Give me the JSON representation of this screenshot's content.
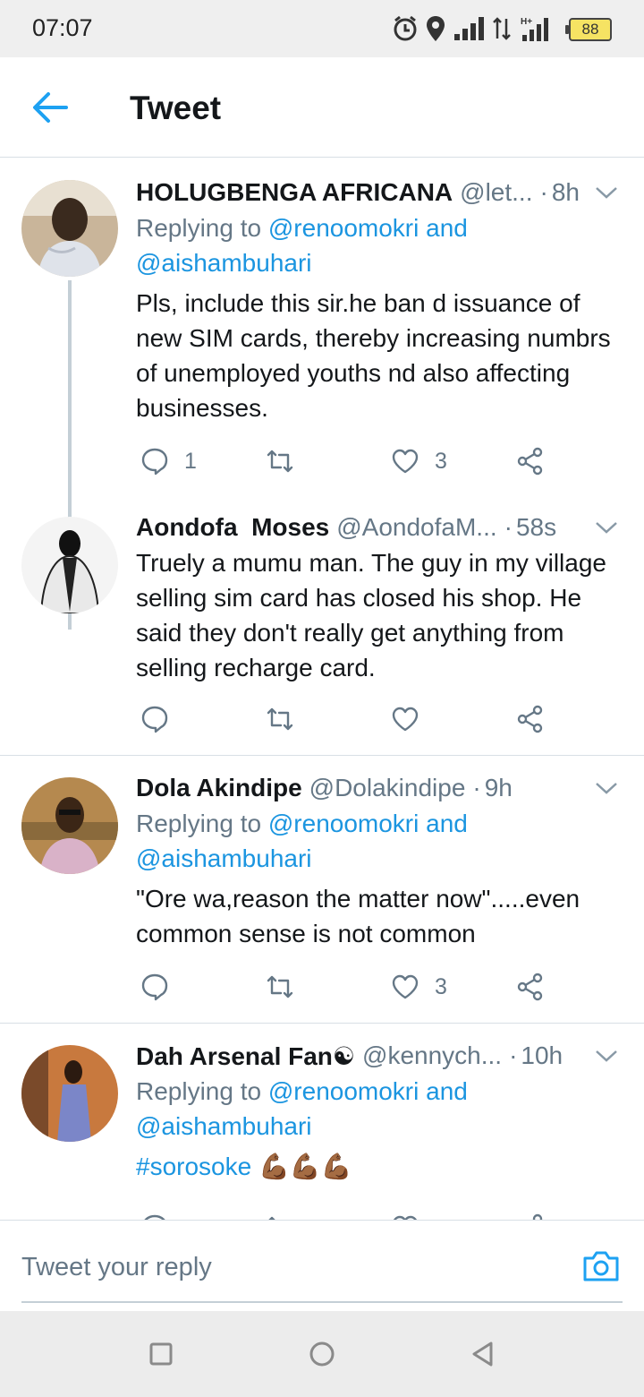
{
  "status_bar": {
    "time": "07:07",
    "battery": "88"
  },
  "header": {
    "title": "Tweet"
  },
  "tweets": [
    {
      "name": "HOLUGBENGA AFRICANA",
      "handle": "@let...",
      "time": "8h",
      "replying_prefix": "Replying to",
      "replying_to": "@renoomokri and",
      "replying_to_2": "@aishambuhari",
      "text": "Pls, include this sir.he ban d issuance of new SIM cards, thereby increasing numbrs of unemployed youths nd also affecting businesses.",
      "replies": "1",
      "likes": "3"
    },
    {
      "name": "Aondofa  Moses",
      "handle": "@AondofaM...",
      "time": "58s",
      "text": "Truely a mumu man. The guy in my village selling sim card has closed his shop. He said they don't really get anything from selling recharge card."
    },
    {
      "name": "Dola Akindipe",
      "handle": "@Dolakindipe",
      "time": "9h",
      "replying_prefix": "Replying to",
      "replying_to": "@renoomokri and",
      "replying_to_2": "@aishambuhari",
      "text": "\"Ore wa,reason the matter now\".....even common sense is not common",
      "likes": "3"
    },
    {
      "name": "Dah Arsenal Fan☯",
      "handle": "@kennych...",
      "time": "10h",
      "replying_prefix": "Replying to",
      "replying_to": "@renoomokri and",
      "replying_to_2": "@aishambuhari",
      "hashtag": "#sorosoke",
      "emoji": "💪🏾💪🏾💪🏾"
    }
  ],
  "reply_bar": {
    "placeholder": "Tweet your reply"
  },
  "icons": {
    "back": "arrow-left-icon",
    "reply": "comment-icon",
    "retweet": "retweet-icon",
    "like": "heart-icon",
    "share": "share-icon",
    "camera": "camera-icon",
    "chevron": "chevron-down-icon"
  },
  "colors": {
    "accent": "#1b95e0",
    "secondary_text": "#657786",
    "divider": "#d8dfe5"
  }
}
